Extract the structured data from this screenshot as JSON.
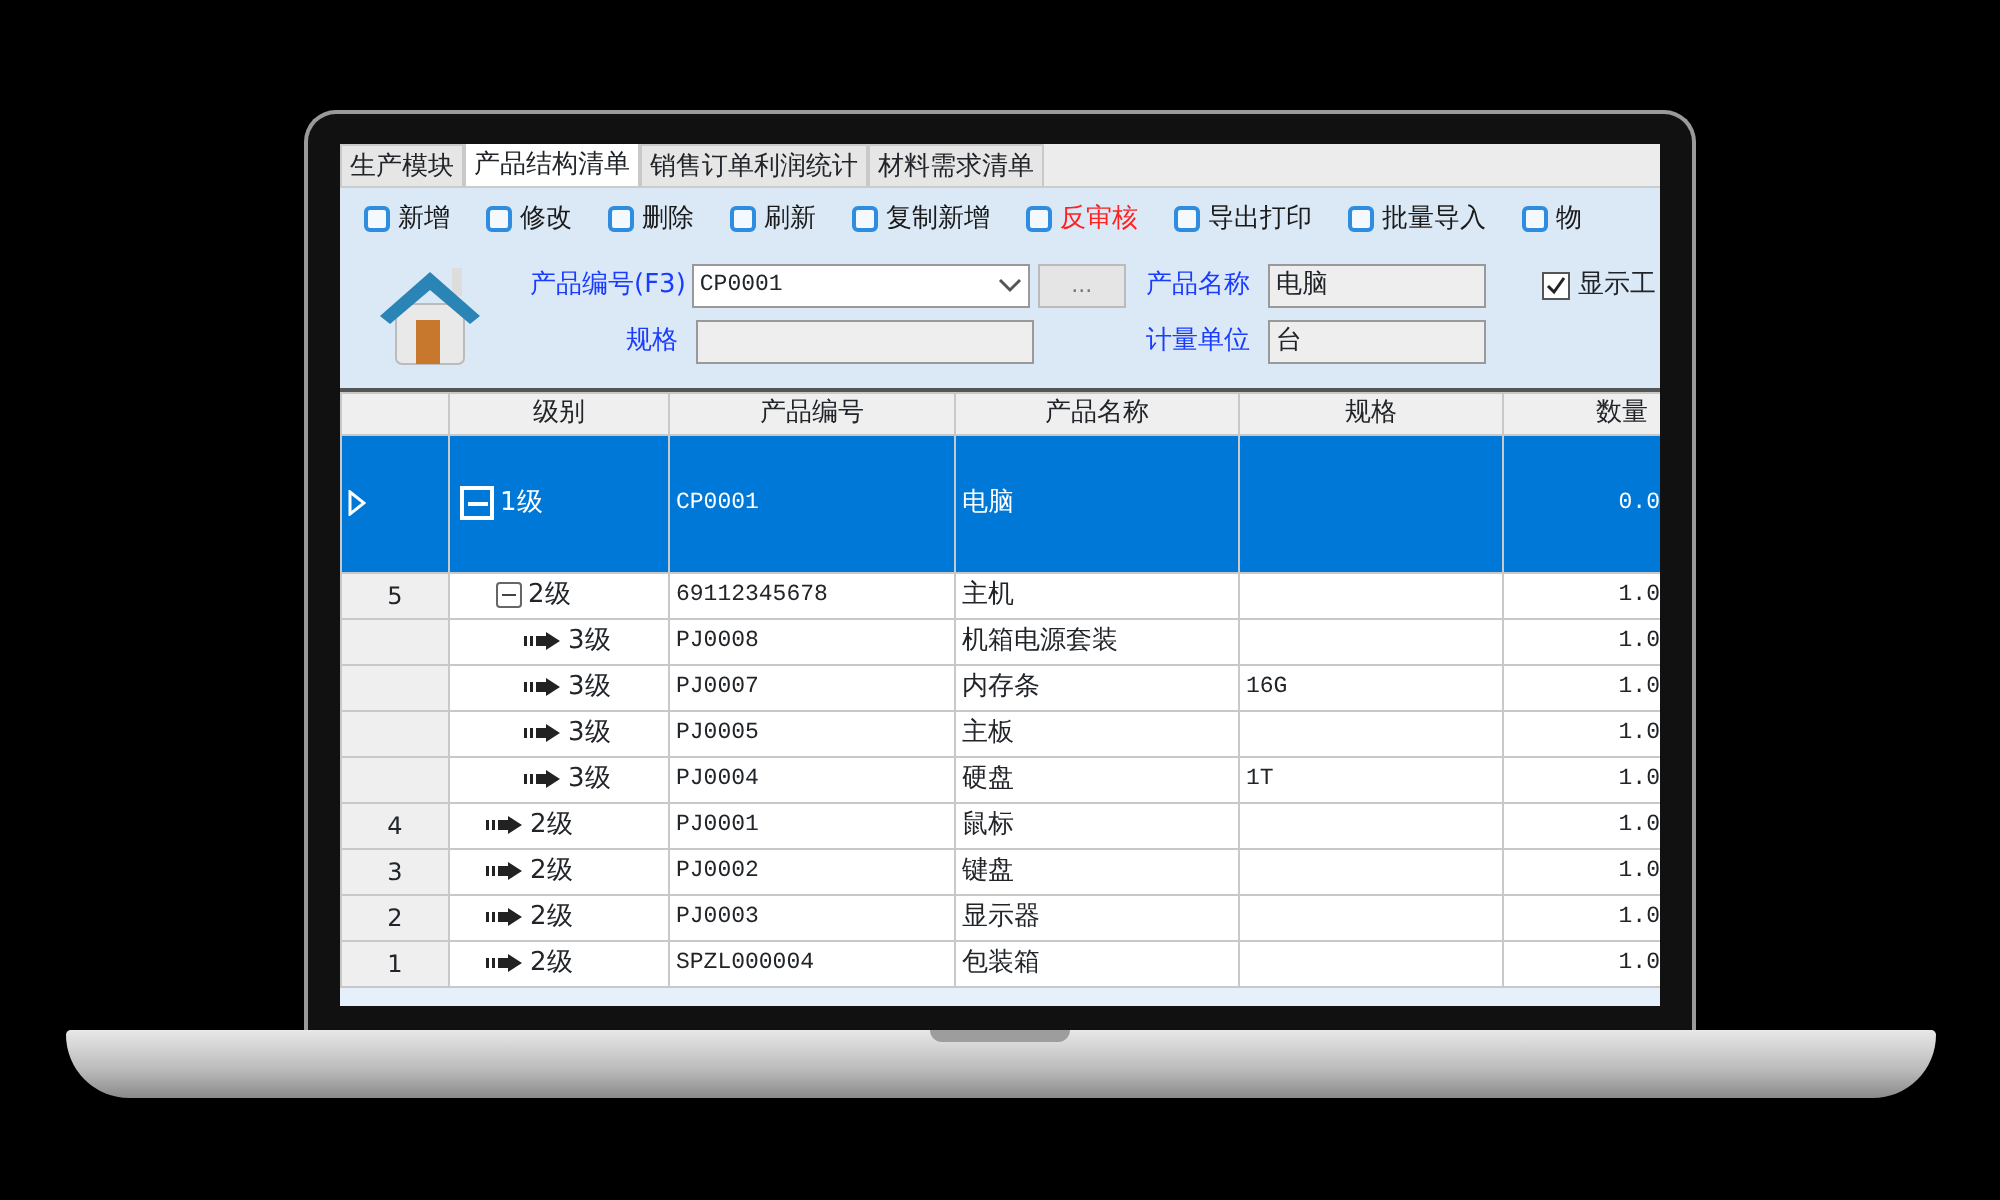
{
  "tabs": [
    {
      "label": "生产模块",
      "selected": false
    },
    {
      "label": "产品结构清单",
      "selected": true
    },
    {
      "label": "销售订单利润统计",
      "selected": false
    },
    {
      "label": "材料需求清单",
      "selected": false
    }
  ],
  "toolbar": [
    {
      "label": "新增",
      "color": "#1a1a1a"
    },
    {
      "label": "修改",
      "color": "#1a1a1a"
    },
    {
      "label": "删除",
      "color": "#1a1a1a"
    },
    {
      "label": "刷新",
      "color": "#1a1a1a"
    },
    {
      "label": "复制新增",
      "color": "#1a1a1a"
    },
    {
      "label": "反审核",
      "color": "#ff2020"
    },
    {
      "label": "导出打印",
      "color": "#1a1a1a"
    },
    {
      "label": "批量导入",
      "color": "#1a1a1a"
    },
    {
      "label": "物",
      "color": "#1a1a1a"
    }
  ],
  "form": {
    "product_code": {
      "label": "产品编号(F3)",
      "value": "CP0001",
      "browse": "..."
    },
    "spec": {
      "label": "规格"
    },
    "product_name": {
      "label": "产品名称",
      "value": "电脑"
    },
    "unit": {
      "label": "计量单位",
      "value": "台"
    },
    "show_option": {
      "label": "显示工",
      "checked": true
    }
  },
  "table": {
    "columns": [
      "级别",
      "产品编号",
      "产品名称",
      "规格",
      "数量"
    ],
    "rows": [
      {
        "kind": "node",
        "expanded": true,
        "selected": true,
        "level": "1级",
        "code": "CP0001",
        "name": "电脑",
        "qty": "0.0",
        "children": [
          {
            "kind": "node",
            "expanded": true,
            "selected": false,
            "row_header": "5",
            "level": "2级",
            "code": "69112345678",
            "name": "主机",
            "qty": "1.0",
            "children": [
              {
                "kind": "leaf",
                "selected": false,
                "level": "3级",
                "code": "PJ0008",
                "name": "机箱电源套装",
                "qty": "1.0"
              },
              {
                "kind": "leaf",
                "selected": false,
                "level": "3级",
                "code": "PJ0007",
                "name": "内存条",
                "spec": "16G",
                "qty": "1.0"
              },
              {
                "kind": "leaf",
                "selected": false,
                "level": "3级",
                "code": "PJ0005",
                "name": "主板",
                "qty": "1.0"
              },
              {
                "kind": "leaf",
                "selected": false,
                "level": "3级",
                "code": "PJ0004",
                "name": "硬盘",
                "spec": "1T",
                "qty": "1.0"
              }
            ]
          },
          {
            "kind": "leaf",
            "selected": false,
            "row_header": "4",
            "level": "2级",
            "code": "PJ0001",
            "name": "鼠标",
            "qty": "1.0"
          },
          {
            "kind": "leaf",
            "selected": false,
            "row_header": "3",
            "level": "2级",
            "code": "PJ0002",
            "name": "键盘",
            "qty": "1.0"
          },
          {
            "kind": "leaf",
            "selected": false,
            "row_header": "2",
            "level": "2级",
            "code": "PJ0003",
            "name": "显示器",
            "qty": "1.0"
          },
          {
            "kind": "leaf",
            "selected": false,
            "row_header": "1",
            "level": "2级",
            "code": "SPZL000004",
            "name": "包装箱",
            "qty": "1.0"
          }
        ]
      }
    ]
  }
}
